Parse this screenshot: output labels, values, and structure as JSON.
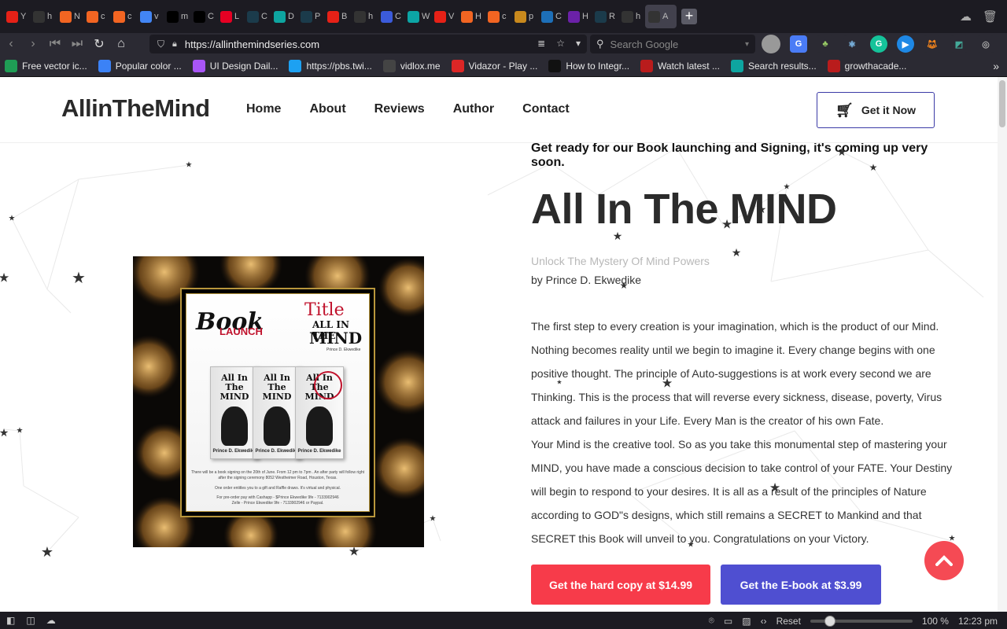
{
  "browser": {
    "tabs": [
      {
        "icon": "youtube-icon",
        "label": "Y",
        "color": "#e62117"
      },
      {
        "icon": "github-icon",
        "label": "h",
        "color": "#333"
      },
      {
        "icon": "chart-icon",
        "label": "N",
        "color": "#f26522"
      },
      {
        "icon": "link-icon",
        "label": "c",
        "color": "#f26522"
      },
      {
        "icon": "link-icon",
        "label": "c",
        "color": "#f26522"
      },
      {
        "icon": "google-icon",
        "label": "v",
        "color": "#4285f4"
      },
      {
        "icon": "triangle-icon",
        "label": "m",
        "color": "#000"
      },
      {
        "icon": "triangle-icon",
        "label": "C",
        "color": "#000"
      },
      {
        "icon": "pinterest-icon",
        "label": "L",
        "color": "#e60023"
      },
      {
        "icon": "react-icon",
        "label": "C",
        "color": "#1b3b4b"
      },
      {
        "icon": "diamond-icon",
        "label": "D",
        "color": "#0ea5a0"
      },
      {
        "icon": "react-icon",
        "label": "P",
        "color": "#1b3b4b"
      },
      {
        "icon": "youtube-icon",
        "label": "B",
        "color": "#e62117"
      },
      {
        "icon": "github-icon",
        "label": "h",
        "color": "#333"
      },
      {
        "icon": "ghost-icon",
        "label": "C",
        "color": "#3b5bdb"
      },
      {
        "icon": "s-icon",
        "label": "W",
        "color": "#0ca5a5"
      },
      {
        "icon": "youtube-icon",
        "label": "V",
        "color": "#e62117"
      },
      {
        "icon": "chart-icon",
        "label": "H",
        "color": "#f26522"
      },
      {
        "icon": "link-icon",
        "label": "c",
        "color": "#f26522"
      },
      {
        "icon": "ethereum-icon",
        "label": "p",
        "color": "#c8891d"
      },
      {
        "icon": "b-icon",
        "label": "C",
        "color": "#1d6fb8"
      },
      {
        "icon": "ta-icon",
        "label": "H",
        "color": "#6b21a8"
      },
      {
        "icon": "react-icon",
        "label": "R",
        "color": "#1b3b4b"
      },
      {
        "icon": "github-icon",
        "label": "h",
        "color": "#333"
      },
      {
        "icon": "book-icon",
        "label": "A",
        "color": "#333"
      }
    ],
    "url": "https://allinthemindseries.com",
    "search_placeholder": "Search Google",
    "bookmarks": [
      {
        "icon": "vector-icon",
        "label": "Free vector ic...",
        "color": "#1f9d55"
      },
      {
        "icon": "palette-icon",
        "label": "Popular color ...",
        "color": "#3b82f6"
      },
      {
        "icon": "ui-icon",
        "label": "UI Design Dail...",
        "color": "#a855f7"
      },
      {
        "icon": "twitter-icon",
        "label": "https://pbs.twi...",
        "color": "#1da1f2"
      },
      {
        "icon": "play-icon",
        "label": "vidlox.me",
        "color": "#444"
      },
      {
        "icon": "v-icon",
        "label": "Vidazor - Play ...",
        "color": "#dc2626"
      },
      {
        "icon": "c-icon",
        "label": "How to Integr...",
        "color": "#111"
      },
      {
        "icon": "watch-icon",
        "label": "Watch latest ...",
        "color": "#b91c1c"
      },
      {
        "icon": "s-icon",
        "label": "Search results...",
        "color": "#0ea5a0"
      },
      {
        "icon": "growth-icon",
        "label": "growthacade...",
        "color": "#b91c1c"
      }
    ],
    "status": {
      "reset_label": "Reset",
      "zoom": "100 %",
      "time": "12:23 pm"
    }
  },
  "site": {
    "logo": "AllinTheMind",
    "nav": [
      "Home",
      "About",
      "Reviews",
      "Author",
      "Contact"
    ],
    "cta_label": "Get it Now",
    "announcement": "Get ready for our Book launching and Signing, it's coming up very soon.",
    "title": "All In The MIND",
    "subtitle": "Unlock The Mystery Of Mind Powers",
    "byline": "by Prince D. Ekwedike",
    "paragraph_1": "The first step to every creation is your imagination, which is the product of our Mind. Nothing becomes reality until we begin to imagine it. Every change begins with one positive thought. The principle of Auto-suggestions is at work every second we are Thinking. This is the process that will reverse every sickness, disease, poverty, Virus attack and failures in your Life. Every Man is the creator of his own Fate.",
    "paragraph_2": "Your Mind is the creative tool. So as you take this monumental step of mastering your MIND, you have made a conscious decision to take control of your FATE. Your Destiny will begin to respond to your desires. It is all as a result of the principles of Nature according to GOD\"s designs, which still remains a SECRET to Mankind and that SECRET this Book will unveil to you. Congratulations on your Victory.",
    "hardcopy_button": "Get the hard copy at $14.99",
    "ebook_button": "Get the E-book at $3.99",
    "colors": {
      "red": "#f73b4a",
      "blue": "#4f4fd1",
      "cta_border": "#3b3aa6"
    },
    "poster": {
      "launch_a": "Book",
      "launch_b": "LAUNCH",
      "title_s": "Title",
      "title_a": "ALL IN THE",
      "title_b": "MIND",
      "author": "Prince D. Ekwedike",
      "book_title": "All In The MIND",
      "book_author": "Prince D. Ekwedike",
      "line_1": "There will be a book signing on the 20th of June. From 12 pm to 7pm . An after party will follow right after the signing ceremony 8052 Westheimer Road, Houston, Texas.",
      "line_2": "One order entitles you to a gift and Raffle draws. It's virtual and physical.",
      "line_3": "For pre-order pay with Cashapp - $Prince Ekwedike 9fe - 7133902946",
      "line_4": "Zelle - Prince Ekwedike 9fe - 7133902946 or Paypal."
    }
  }
}
